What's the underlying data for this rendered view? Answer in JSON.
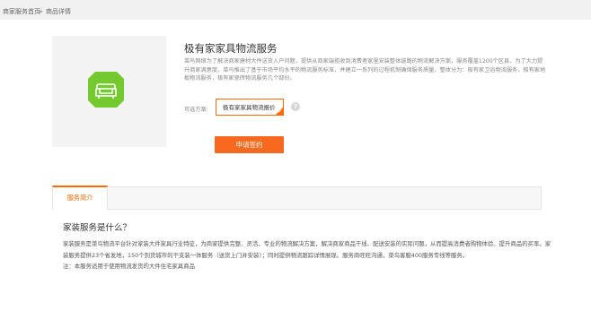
{
  "breadcrumb": {
    "home": "商家服务首页",
    "separator": ">",
    "current": "商品详情"
  },
  "product": {
    "icon": "sofa-icon",
    "title": "极有家家具物流服务",
    "description": "菜鸟网络为了解决商家建材大件送货入户问题，提供从商家端揽收到消费者家里安装整体链路的物流解决方案，服务覆盖1200个区县，为了大力提升商家满意度，菜鸟推出了基于市场平均水平的物流服务标准，并建立一系列的过程机制确保服务质量，整体分为：极有家卫浴物流服务，极有家地板物流服务，极有家瓷砖物流服务几个部份。"
  },
  "options": {
    "label": "可选方案:",
    "selected": "极有家家具物流报价",
    "check": "✓",
    "help": "?"
  },
  "apply_button": "申请签约",
  "tabs": [
    {
      "label": "服务简介",
      "active": true
    }
  ],
  "intro": {
    "heading": "家装服务是什么？",
    "paragraphs": [
      "家装服务是菜鸟物流平台针对家装大件家具行业特征，为商家提供完整、灵活、专业的物流解决方案，解决商家商品干线、配送安装的实际问题，从而提高消费者购物体验、提升商品的买率。家装服务提供23个省发地，150个到货城市的干支装一体服务（送货上门并安装）；同时提供物流跟踪详情展现、服务商旺旺沟通，菜鸟客服400服务专线等服务。",
      "注：本服务适用于使用物流发货的大件住宅家具商品"
    ]
  },
  "colors": {
    "accent": "#ff6a00",
    "button": "#f56a1e",
    "icon_green": "#73c92d"
  }
}
